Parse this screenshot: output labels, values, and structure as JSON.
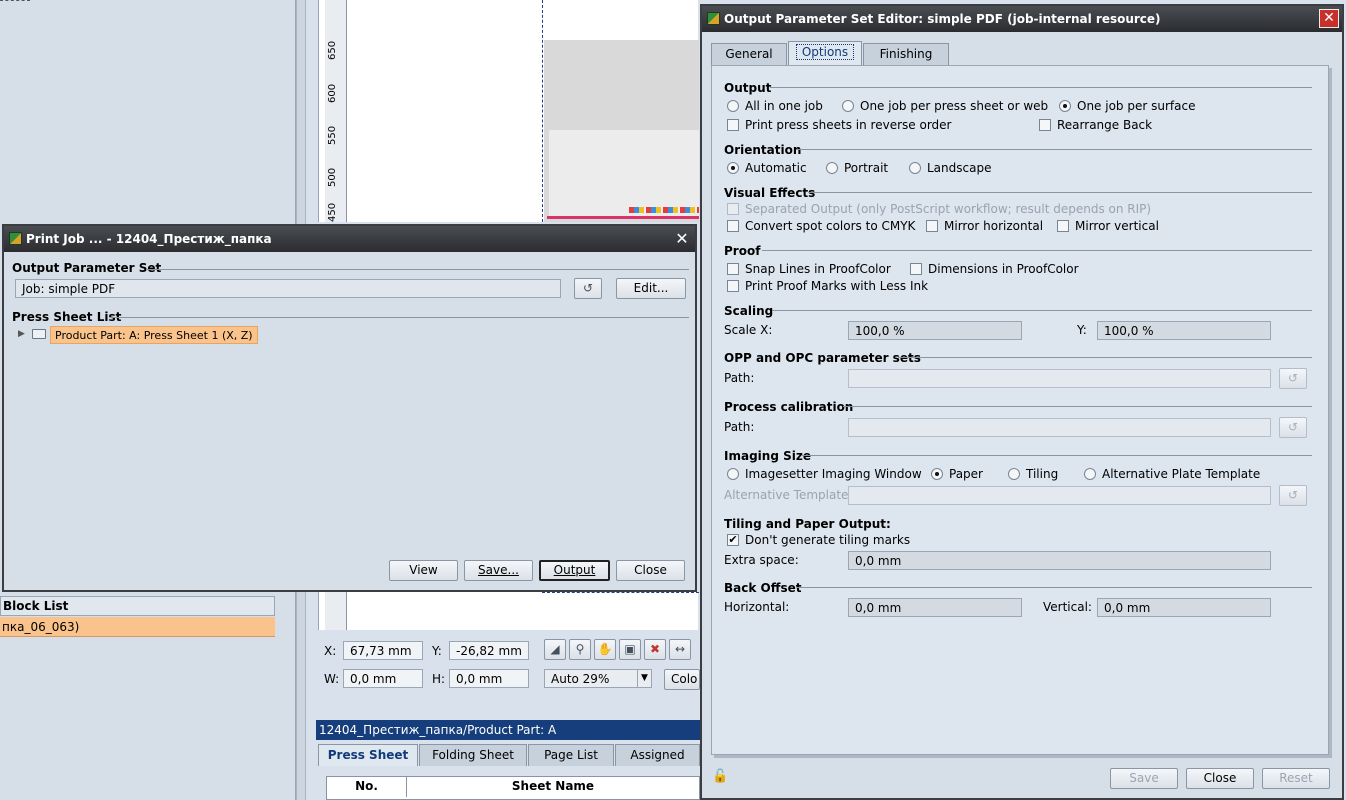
{
  "bg": {
    "block_list_title": "Block List",
    "block_list_item": "пка_06_063)",
    "ruler_ticks": [
      "650",
      "600",
      "550",
      "500",
      "450"
    ],
    "coords": {
      "x_label": "X:",
      "x_value": "67,73 mm",
      "y_label": "Y:",
      "y_value": "-26,82 mm",
      "w_label": "W:",
      "w_value": "0,0 mm",
      "h_label": "H:",
      "h_value": "0,0 mm",
      "zoom": "Auto 29%",
      "color_label": "Colo"
    },
    "breadcrumb": "12404_Престиж_папка/Product Part: A",
    "tabs": [
      "Press Sheet",
      "Folding Sheet",
      "Page List",
      "Assigned"
    ],
    "table_headers": [
      "No.",
      "Sheet Name"
    ]
  },
  "print_job": {
    "title": "Print Job ... - 12404_Престиж_папка",
    "ops_label": "Output Parameter Set",
    "ops_value": "Job: simple PDF",
    "edit_label": "Edit...",
    "press_sheet_list_label": "Press Sheet List",
    "tree_item": "Product Part: A: Press Sheet 1 (X, Z)",
    "buttons": {
      "view": "View",
      "save": "Save...",
      "output": "Output",
      "close": "Close"
    }
  },
  "editor": {
    "title": "Output Parameter Set Editor: simple PDF (job-internal resource)",
    "tabs": [
      "General",
      "Options",
      "Finishing"
    ],
    "output": {
      "label": "Output",
      "all_in_one": "All in one job",
      "per_press_sheet": "One job per press sheet or web",
      "per_surface": "One job per surface",
      "reverse": "Print press sheets in reverse order",
      "rearrange_back": "Rearrange Back"
    },
    "orientation": {
      "label": "Orientation",
      "automatic": "Automatic",
      "portrait": "Portrait",
      "landscape": "Landscape"
    },
    "visual": {
      "label": "Visual Effects",
      "separated": "Separated Output (only PostScript workflow; result depends on RIP)",
      "spot_to_cmyk": "Convert spot colors to CMYK",
      "mirror_h": "Mirror horizontal",
      "mirror_v": "Mirror vertical"
    },
    "proof": {
      "label": "Proof",
      "snap_lines": "Snap Lines in ProofColor",
      "dimensions": "Dimensions in ProofColor",
      "less_ink": "Print Proof Marks with Less Ink"
    },
    "scaling": {
      "label": "Scaling",
      "x_label": "Scale X:",
      "x_value": "100,0 %",
      "y_label": "Y:",
      "y_value": "100,0 %"
    },
    "opp": {
      "label": "OPP and OPC parameter sets",
      "path_label": "Path:",
      "path_value": ""
    },
    "calibration": {
      "label": "Process calibration",
      "path_label": "Path:",
      "path_value": ""
    },
    "imaging": {
      "label": "Imaging Size",
      "imagesetter": "Imagesetter Imaging Window",
      "paper": "Paper",
      "tiling": "Tiling",
      "alt_plate": "Alternative Plate Template",
      "alt_template_label": "Alternative Template:",
      "alt_template_value": ""
    },
    "tiling": {
      "label": "Tiling and Paper Output:",
      "no_marks": "Don't generate tiling marks",
      "extra_label": "Extra space:",
      "extra_value": "0,0 mm"
    },
    "back_offset": {
      "label": "Back Offset",
      "h_label": "Horizontal:",
      "h_value": "0,0 mm",
      "v_label": "Vertical:",
      "v_value": "0,0 mm"
    },
    "buttons": {
      "save": "Save",
      "close": "Close",
      "reset": "Reset"
    }
  }
}
